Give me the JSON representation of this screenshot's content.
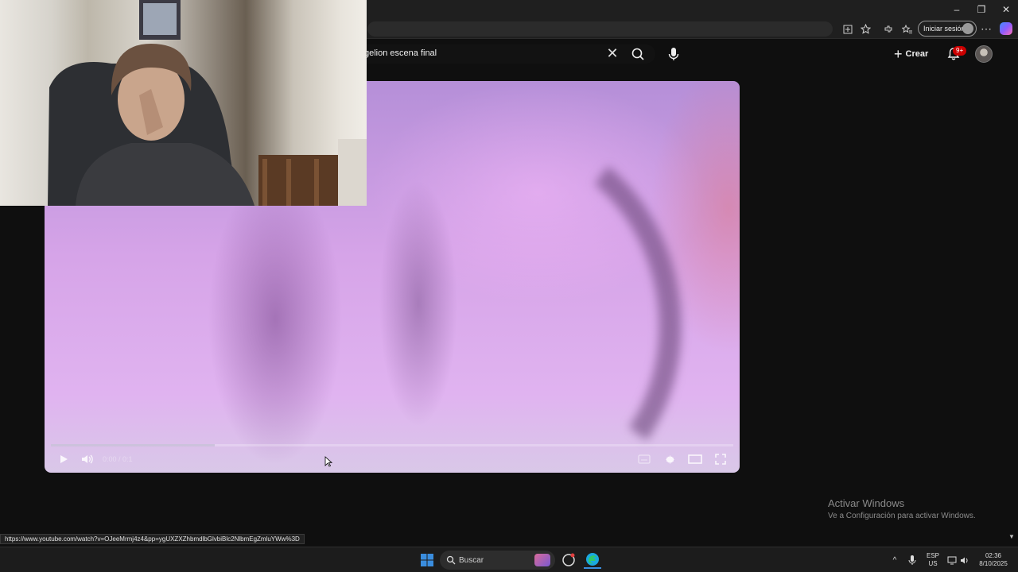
{
  "browser": {
    "window_controls": [
      "–",
      "❐",
      "✕"
    ],
    "signin_label": "Iniciar sesión",
    "status_url": "https://www.youtube.com/watch?v=OJeeMrmj4z4&pp=ygUXZXZhbmdlbGlvbiBlc2NlbmEgZmluYWw%3D"
  },
  "youtube": {
    "search_query": "gelion escena final",
    "create_label": "Crear",
    "notification_badge": "9+",
    "player": {
      "time_text": "0:00 / 0:1",
      "progress": 0.24
    }
  },
  "overlay": {
    "activate_title": "Activar Windows",
    "activate_subtitle": "Ve a Configuración para activar Windows."
  },
  "taskbar": {
    "search_label": "Buscar",
    "lang_top": "ESP",
    "lang_bottom": "US",
    "time": "02:36",
    "date": "8/10/2025"
  },
  "colors": {
    "accent_blue": "#3a8dde",
    "badge_red": "#cc0000",
    "page_bg": "#0f0f0f"
  }
}
